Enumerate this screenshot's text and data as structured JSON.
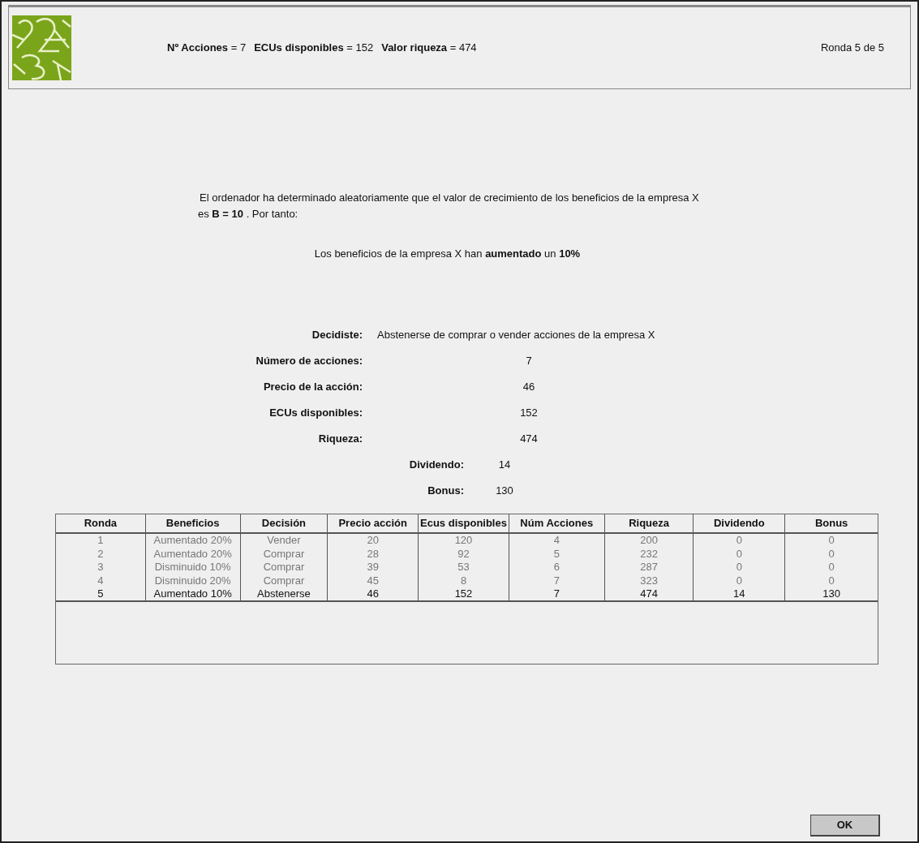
{
  "header": {
    "stats": [
      "**Nº Acciones** = 7",
      "**ECUs disponibles** = 152",
      "**Valor riqueza** = 474"
    ],
    "round": "Ronda 5 de 5"
  },
  "message": {
    "intro": "El ordenador ha determinado aleatoriamente que el valor de crecimiento de los beneficios de la empresa X",
    "intro_line2": "es  **B = 10** . Por tanto:",
    "result": "Los beneficios de la empresa X han **aumentado** un **10%**"
  },
  "details": [
    {
      "label": "Decidiste:",
      "value": "Abstenerse de comprar o vender acciones de la empresa X",
      "kind": "inline"
    },
    {
      "label": "Número de acciones:",
      "value": "7",
      "kind": "column"
    },
    {
      "label": "Precio de la acción:",
      "value": "46",
      "kind": "column"
    },
    {
      "label": "ECUs disponibles:",
      "value": "152",
      "kind": "column"
    },
    {
      "label": "Riqueza:",
      "value": "474",
      "kind": "column"
    },
    {
      "label": "Dividendo:",
      "value": "14",
      "kind": "short"
    },
    {
      "label": "Bonus:",
      "value": "130",
      "kind": "short"
    }
  ],
  "table": {
    "columns": [
      "Ronda",
      "Beneficios",
      "Decisión",
      "Precio acción",
      "Ecus disponibles",
      "Núm Acciones",
      "Riqueza",
      "Dividendo",
      "Bonus"
    ],
    "rows": [
      {
        "cells": [
          "1",
          "Aumentado 20%",
          "Vender",
          "20",
          "120",
          "4",
          "200",
          "0",
          "0"
        ],
        "current": false
      },
      {
        "cells": [
          "2",
          "Aumentado 20%",
          "Comprar",
          "28",
          "92",
          "5",
          "232",
          "0",
          "0"
        ],
        "current": false
      },
      {
        "cells": [
          "3",
          "Disminuido 10%",
          "Comprar",
          "39",
          "53",
          "6",
          "287",
          "0",
          "0"
        ],
        "current": false
      },
      {
        "cells": [
          "4",
          "Disminuido 20%",
          "Comprar",
          "45",
          "8",
          "7",
          "323",
          "0",
          "0"
        ],
        "current": false
      },
      {
        "cells": [
          "5",
          "Aumentado 10%",
          "Abstenerse",
          "46",
          "152",
          "7",
          "474",
          "14",
          "130"
        ],
        "current": true
      }
    ]
  },
  "buttons": [
    "OK"
  ]
}
